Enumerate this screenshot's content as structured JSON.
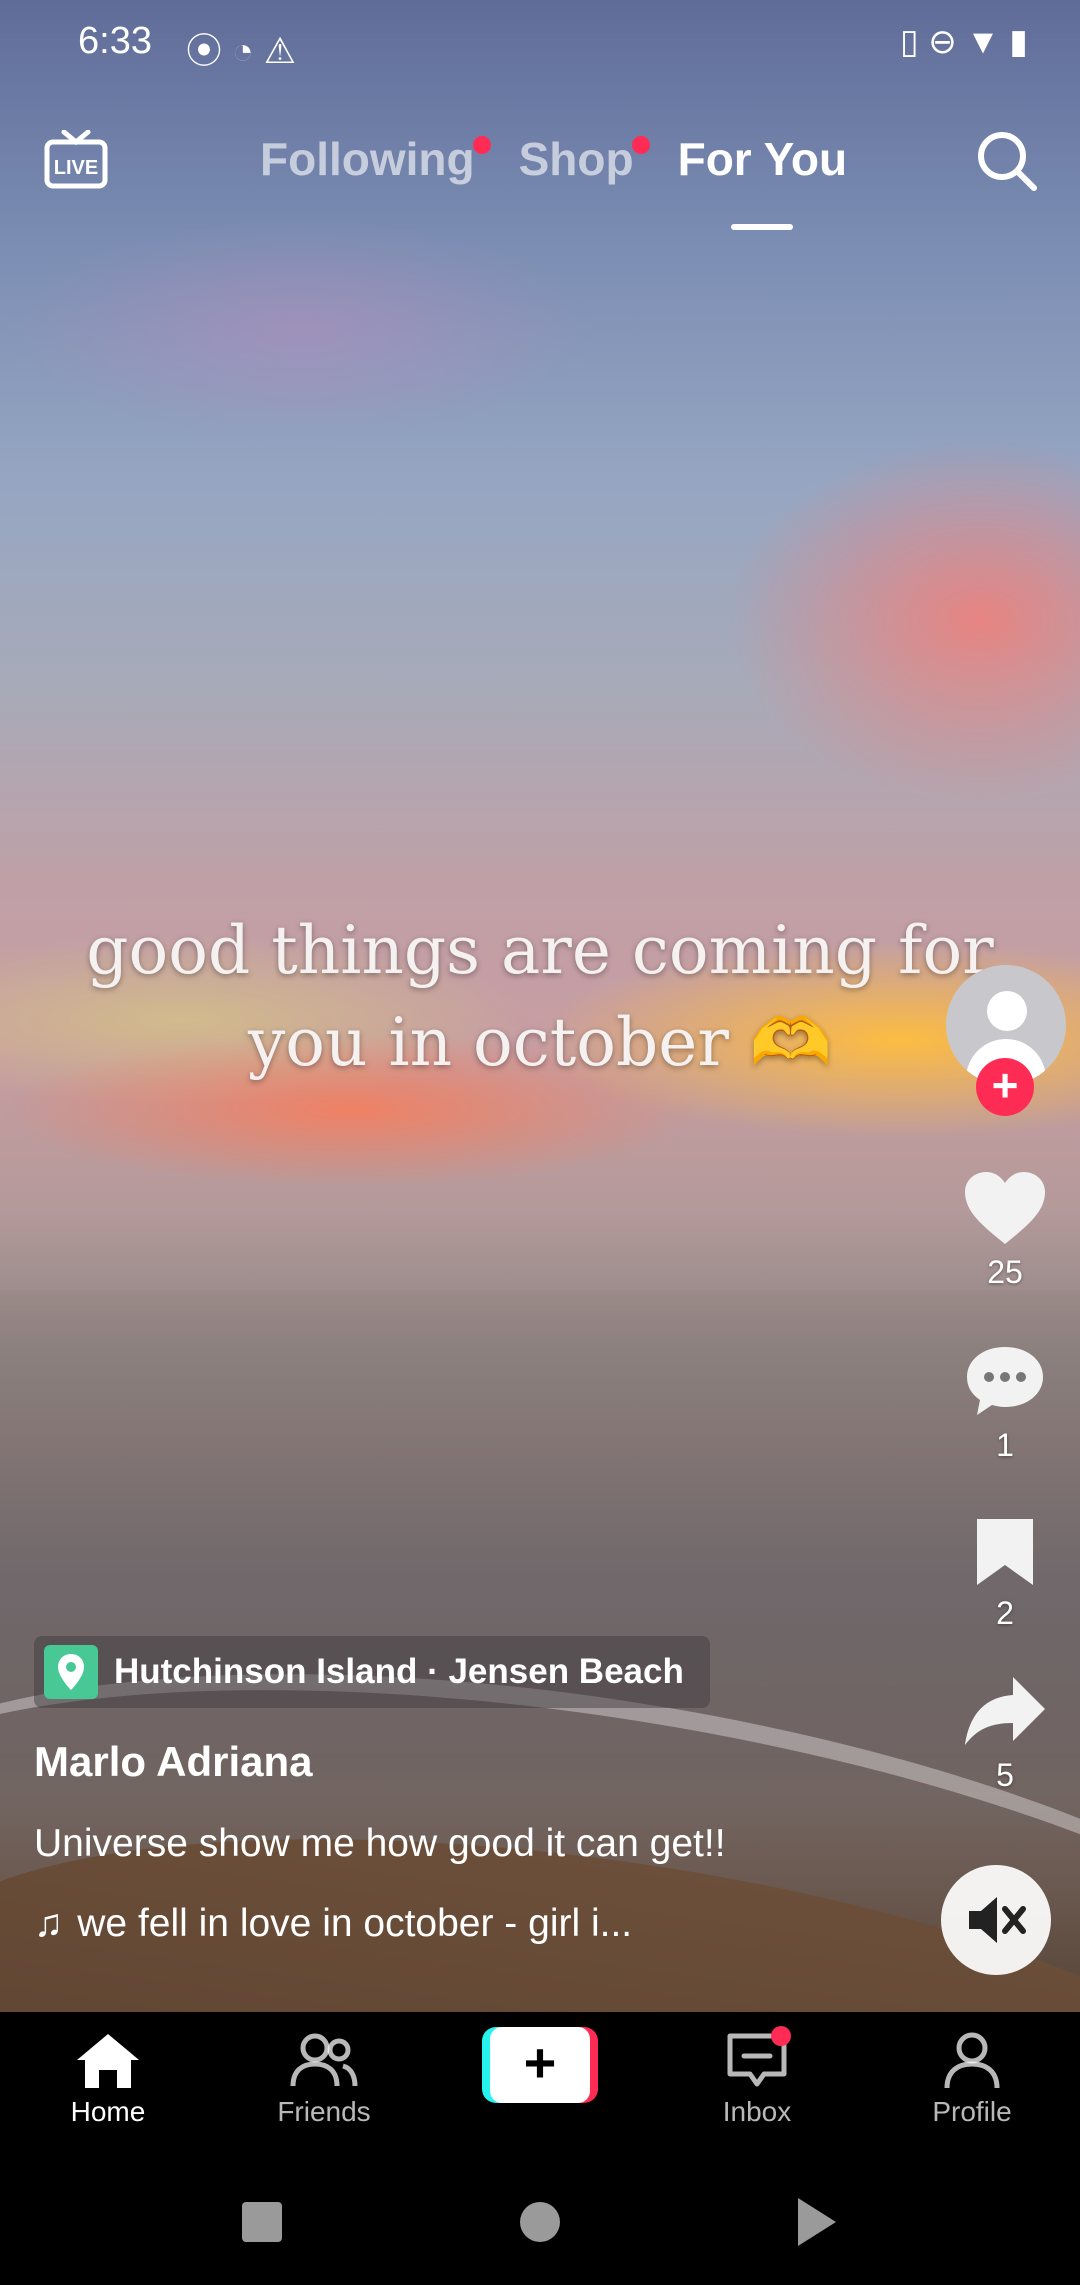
{
  "status_bar": {
    "time": "6:33",
    "left_icons": [
      "record-icon",
      "sync-icon",
      "warning-icon"
    ],
    "right_icons": [
      "vibrate-icon",
      "dnd-icon",
      "wifi-icon",
      "battery-charging-icon"
    ]
  },
  "top_nav": {
    "tabs": [
      {
        "label": "Following",
        "has_dot": true
      },
      {
        "label": "Shop",
        "has_dot": true
      },
      {
        "label": "For You",
        "active": true
      }
    ]
  },
  "video": {
    "overlay_line1": "good things are coming for",
    "overlay_line2": "you in october 🫶",
    "location": "Hutchinson Island · Jensen Beach",
    "username": "Marlo Adriana",
    "caption": "Universe show me how good it can get!!",
    "music": "we fell in love in october - girl i..."
  },
  "actions": {
    "likes": "25",
    "comments": "1",
    "saves": "2",
    "shares": "5"
  },
  "bottom_nav": {
    "home": "Home",
    "friends": "Friends",
    "inbox": "Inbox",
    "profile": "Profile"
  },
  "colors": {
    "accent": "#fe2c55",
    "cyan": "#25f4ee",
    "location_pin": "#48c894"
  }
}
